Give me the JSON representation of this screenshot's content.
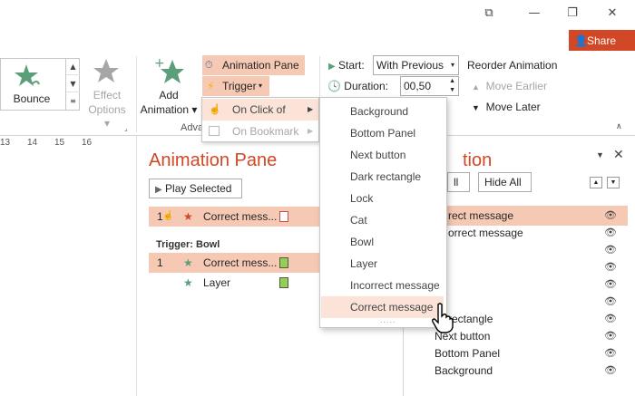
{
  "window": {
    "restore_glyph": "⧉",
    "minimize_glyph": "—",
    "maximize_glyph": "❐",
    "close_glyph": "✕",
    "share_label": "Share"
  },
  "ribbon": {
    "effect_gallery": {
      "selected": "Bounce"
    },
    "effect_options": {
      "line1": "Effect",
      "line2": "Options"
    },
    "add_animation": {
      "line1": "Add",
      "line2": "Animation"
    },
    "animation_pane_label": "Animation Pane",
    "trigger_label": "Trigger",
    "group_label_partial": "Adva",
    "start_label": "Start:",
    "start_value": "With Previous",
    "duration_label": "Duration:",
    "duration_value": "00,50",
    "reorder_label": "Reorder Animation",
    "move_earlier_label": "Move Earlier",
    "move_later_label": "Move Later"
  },
  "trigger_menu": {
    "items": [
      {
        "label": "On Click of",
        "has_submenu": true,
        "enabled": true
      },
      {
        "label": "On Bookmark",
        "has_submenu": true,
        "enabled": false
      }
    ]
  },
  "click_of_submenu": {
    "items": [
      "Background",
      "Bottom Panel",
      "Next button",
      "Dark rectangle",
      "Lock",
      "Cat",
      "Bowl",
      "Layer",
      "Incorrect message",
      "Correct message"
    ],
    "hovered": "Correct message",
    "more_glyph": "....."
  },
  "ruler": {
    "ticks": [
      "13",
      "14",
      "15",
      "16"
    ]
  },
  "animation_pane": {
    "title": "Animation Pane",
    "play_label": "Play Selected",
    "rows": [
      {
        "num": "1",
        "name": "Correct mess...",
        "color": "#f6c9b4"
      },
      {
        "num": "1",
        "name": "Correct mess...",
        "color": "#f6c9b4"
      },
      {
        "num": "",
        "name": "Layer",
        "color": ""
      }
    ],
    "trigger_heading": "Trigger: Bowl"
  },
  "selection_pane": {
    "title_partial": "tion",
    "show_all_partial": "ll",
    "hide_all_label": "Hide All",
    "items": [
      "rect message",
      "orrect message",
      "rectangle",
      "Next button",
      "Bottom Panel",
      "Background"
    ]
  },
  "colors": {
    "accent": "#d24726",
    "highlight": "#f6c9b4",
    "green_box": "#92d050"
  }
}
